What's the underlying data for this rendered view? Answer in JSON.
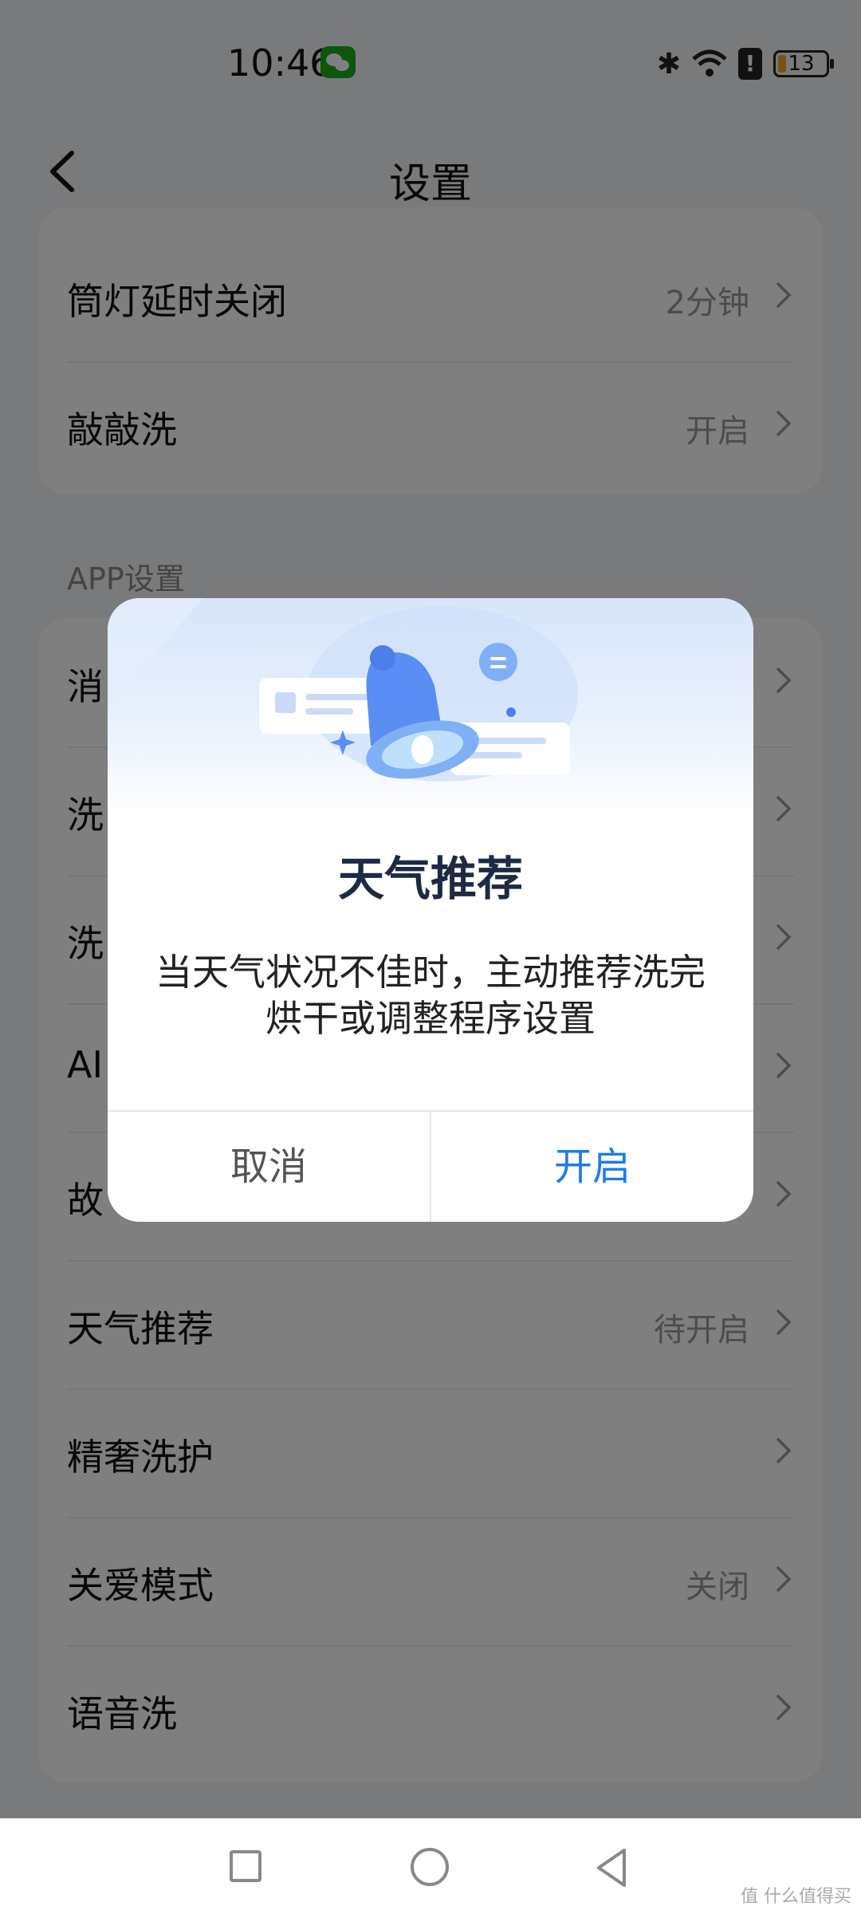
{
  "status_bar": {
    "time": "10:46",
    "battery": "13"
  },
  "header": {
    "title": "设置"
  },
  "group1": [
    {
      "label": "筒灯延时关闭",
      "value": "2分钟"
    },
    {
      "label": "敲敲洗",
      "value": "开启"
    }
  ],
  "section_title": "APP设置",
  "group2": [
    {
      "label": "消",
      "value": ""
    },
    {
      "label": "洗",
      "value": ""
    },
    {
      "label": "洗",
      "value": ""
    },
    {
      "label": "AI",
      "value": ""
    },
    {
      "label": "故",
      "value": ""
    },
    {
      "label": "天气推荐",
      "value": "待开启"
    },
    {
      "label": "精奢洗护",
      "value": ""
    },
    {
      "label": "关爱模式",
      "value": "关闭"
    },
    {
      "label": "语音洗",
      "value": ""
    }
  ],
  "dialog": {
    "title": "天气推荐",
    "message": "当天气状况不佳时，主动推荐洗完烘干或调整程序设置",
    "cancel_label": "取消",
    "confirm_label": "开启"
  },
  "watermark": "值 什么值得买",
  "colors": {
    "accent": "#1f7bea",
    "overlay": "rgba(0,0,0,0.5)"
  }
}
